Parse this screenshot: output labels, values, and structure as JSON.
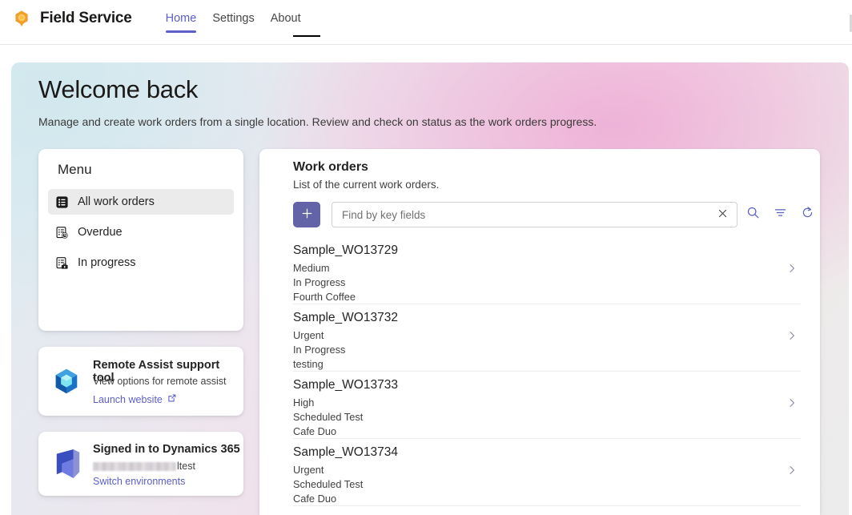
{
  "appbar": {
    "logo_icon": "field-service-hex-logo",
    "title": "Field Service",
    "nav": [
      {
        "label": "Home",
        "active": true
      },
      {
        "label": "Settings",
        "active": false
      },
      {
        "label": "About",
        "active": false
      }
    ]
  },
  "hero": {
    "title": "Welcome back",
    "subtitle": "Manage and create work orders from a single location. Review and check on status as the work orders progress."
  },
  "menu": {
    "title": "Menu",
    "items": [
      {
        "label": "All work orders",
        "icon": "list-filled-icon",
        "selected": true
      },
      {
        "label": "Overdue",
        "icon": "document-clock-icon",
        "selected": false
      },
      {
        "label": "In progress",
        "icon": "document-toolbox-icon",
        "selected": false
      }
    ]
  },
  "remote_assist": {
    "icon": "remote-assist-cube-icon",
    "title": "Remote Assist support tool",
    "subtitle": "View options for remote assist",
    "link_label": "Launch website",
    "link_icon": "open-in-new-icon"
  },
  "dynamics": {
    "icon": "dynamics-365-icon",
    "title": "Signed in to Dynamics 365",
    "env_suffix": "ltest",
    "link_label": "Switch environments"
  },
  "work_orders": {
    "title": "Work orders",
    "subtitle": "List of the current work orders.",
    "add_label": "+",
    "search_placeholder": "Find by key fields",
    "search_value": "",
    "clear_icon": "close-icon",
    "tools": [
      {
        "icon": "search-icon"
      },
      {
        "icon": "filter-icon"
      },
      {
        "icon": "refresh-icon"
      }
    ],
    "rows": [
      {
        "name": "Sample_WO13729",
        "priority": "Medium",
        "status": "In Progress",
        "account": "Fourth Coffee"
      },
      {
        "name": "Sample_WO13732",
        "priority": "Urgent",
        "status": "In Progress",
        "account": "testing"
      },
      {
        "name": "Sample_WO13733",
        "priority": "High",
        "status": "Scheduled Test",
        "account": "Cafe Duo"
      },
      {
        "name": "Sample_WO13734",
        "priority": "Urgent",
        "status": "Scheduled Test",
        "account": "Cafe Duo"
      }
    ]
  },
  "colors": {
    "accent_purple": "#5b5fc7",
    "button_purple": "#6264a7",
    "logo_orange": "#f2a33c",
    "dynamics_blue": "#2266cc",
    "remote_blue": "#2d8fd5"
  }
}
